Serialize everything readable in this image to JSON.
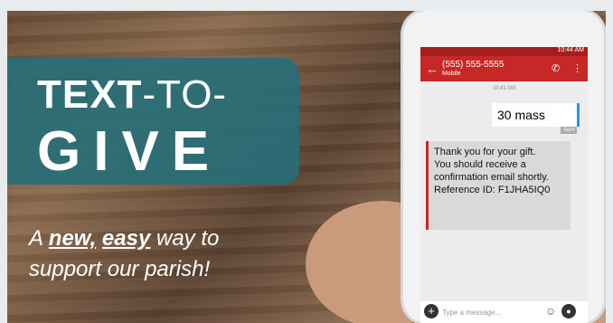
{
  "banner": {
    "title_bold": "TEXT",
    "title_thin": "-TO-",
    "title_big": "GIVE",
    "sub_a": "A ",
    "sub_new": "new,",
    "sub_easy": "easy",
    "sub_rest": " way to",
    "sub_line2": "support our parish!"
  },
  "phone": {
    "status_time": "10:44 AM",
    "contact_number": "(555) 555-5555",
    "contact_type": "Mobile",
    "timestamp": "10:41 AM",
    "outgoing_message": "30 mass",
    "sent_label": "Sent",
    "reply_lines": [
      "Thank you for your gift.",
      "You should receive a",
      "confirmation email shortly.",
      "Reference ID: F1JHA5IQ0"
    ],
    "input_placeholder": "Type a message...",
    "icons": {
      "back": "back-arrow-icon",
      "call": "phone-icon",
      "more": "more-vert-icon",
      "add": "plus-icon",
      "emoji": "emoji-icon",
      "mic": "mic-icon"
    }
  },
  "colors": {
    "teal": "#286e78",
    "red": "#c62828",
    "blue": "#2196f3"
  }
}
